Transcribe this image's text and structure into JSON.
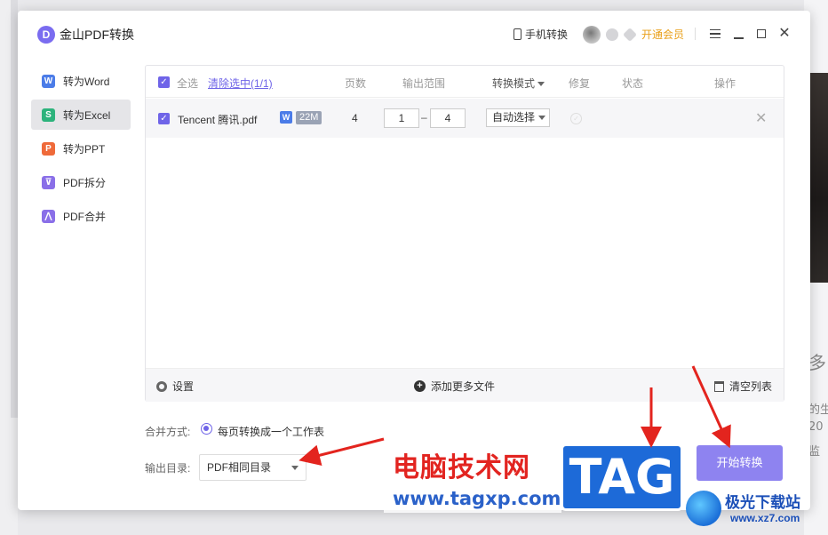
{
  "app": {
    "title": "金山PDF转换",
    "logo_glyph": "D"
  },
  "titlebar": {
    "mobile_convert": "手机转换",
    "vip_link": "开通会员"
  },
  "sidebar": {
    "items": [
      {
        "label": "转为Word",
        "glyph": "W",
        "color": "#4b7ce8"
      },
      {
        "label": "转为Excel",
        "glyph": "S",
        "color": "#2db37c",
        "active": true
      },
      {
        "label": "转为PPT",
        "glyph": "P",
        "color": "#ef6a3a"
      },
      {
        "label": "PDF拆分",
        "glyph": "⊽",
        "color": "#8a6fe8"
      },
      {
        "label": "PDF合并",
        "glyph": "⋀",
        "color": "#8a6fe8"
      }
    ]
  },
  "table": {
    "headers": {
      "select_all": "全选",
      "clear_selected": "清除选中(1/1)",
      "pages": "页数",
      "output_range": "输出范围",
      "mode": "转换模式",
      "repair": "修复",
      "status": "状态",
      "action": "操作"
    },
    "rows": [
      {
        "file_name": "Tencent 腾讯.pdf",
        "file_badge": "W",
        "size": "22M",
        "pages": "4",
        "range_from": "1",
        "range_to": "4",
        "mode": "自动选择"
      }
    ],
    "footer": {
      "settings": "设置",
      "add_more": "添加更多文件",
      "clear_list": "清空列表"
    }
  },
  "options": {
    "merge_label": "合并方式:",
    "merge_value": "每页转换成一个工作表",
    "output_label": "输出目录:",
    "output_value": "PDF相同目录"
  },
  "actions": {
    "start": "开始转换"
  },
  "watermark": {
    "site_cn": "电脑技术网",
    "site_url": "www.tagxp.com",
    "tag": "TAG",
    "jg_name": "极光下载站",
    "jg_url": "www.xz7.com"
  },
  "background": {
    "text1": "多",
    "text2": "的生",
    "text3": "20",
    "text4": "监"
  },
  "colors": {
    "accent": "#6f64e8",
    "start_button": "#8e83f0",
    "vip": "#e9a01b"
  }
}
